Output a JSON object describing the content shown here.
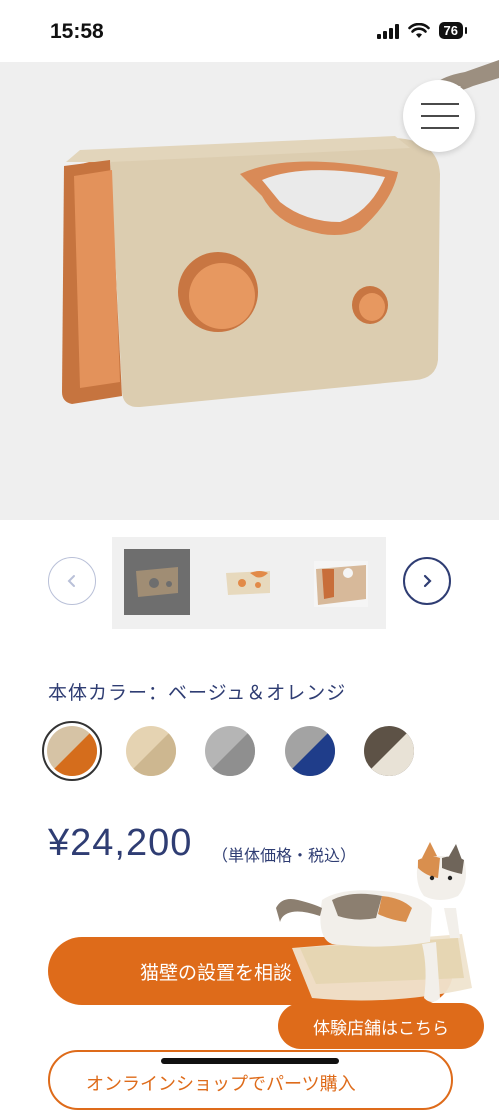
{
  "status_bar": {
    "time": "15:58",
    "battery": "76"
  },
  "hero": {
    "menu_icon": "hamburger-icon"
  },
  "gallery": {
    "prev_icon": "chevron-left-icon",
    "next_icon": "chevron-right-icon",
    "thumbnails": [
      "thumbnail-1",
      "thumbnail-2",
      "thumbnail-3"
    ],
    "active_index": 0
  },
  "product": {
    "color_label": "本体カラー：ベージュ＆オレンジ",
    "swatches": [
      {
        "name": "beige-orange",
        "colors": [
          "#d6c3a5",
          "#d56d1c"
        ],
        "selected": true
      },
      {
        "name": "beige",
        "colors": [
          "#e5d3b2",
          "#cdb790"
        ],
        "selected": false
      },
      {
        "name": "gray",
        "colors": [
          "#b5b5b5",
          "#8f8f8f"
        ],
        "selected": false
      },
      {
        "name": "gray-navy",
        "colors": [
          "#a3a3a3",
          "#1f3d8a"
        ],
        "selected": false
      },
      {
        "name": "brown-cream",
        "colors": [
          "#5d5246",
          "#e8e2d6"
        ],
        "selected": false
      }
    ],
    "price": "¥24,200",
    "price_note": "（単体価格・税込）"
  },
  "actions": {
    "consult_label": "猫壁の設置を相談",
    "store_label": "体験店舗はこちら",
    "online_label": "オンラインショップでパーツ購入"
  },
  "colors": {
    "accent": "#de6b1a",
    "navy": "#2f3d73"
  }
}
